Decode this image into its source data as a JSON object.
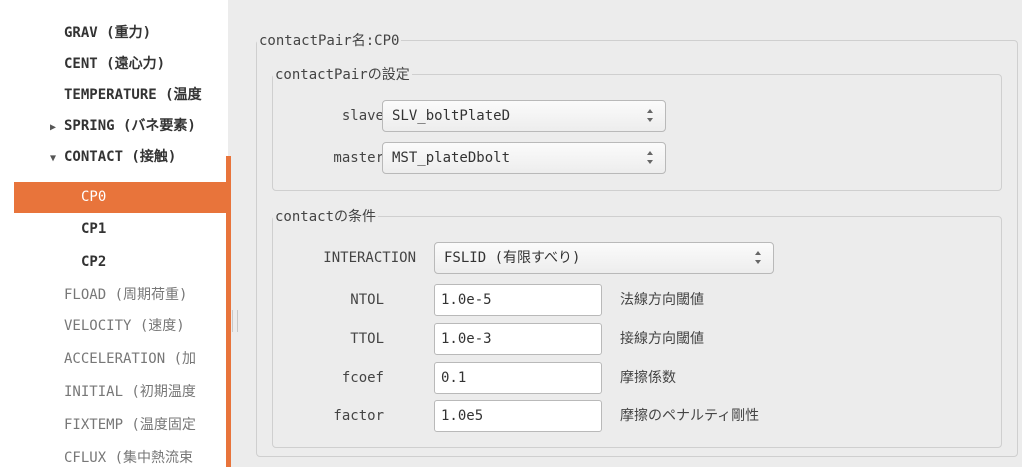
{
  "tree": {
    "items": [
      {
        "label": "GRAV (重力)",
        "style": "bold"
      },
      {
        "label": "CENT (遠心力)",
        "style": "bold"
      },
      {
        "label": "TEMPERATURE (温度",
        "style": "bold"
      },
      {
        "label": "SPRING (バネ要素)",
        "style": "bold",
        "arrow": "▶"
      },
      {
        "label": "CONTACT (接触)",
        "style": "bold",
        "arrow": "▼"
      },
      {
        "label": "CP0",
        "style": "selected"
      },
      {
        "label": "CP1",
        "style": "bold"
      },
      {
        "label": "CP2",
        "style": "bold"
      },
      {
        "label": "FLOAD (周期荷重)",
        "style": "gray"
      },
      {
        "label": "VELOCITY (速度)",
        "style": "gray"
      },
      {
        "label": "ACCELERATION (加",
        "style": "gray"
      },
      {
        "label": "INITIAL (初期温度",
        "style": "gray"
      },
      {
        "label": "FIXTEMP (温度固定",
        "style": "gray"
      },
      {
        "label": "CFLUX (集中熱流束",
        "style": "gray"
      }
    ]
  },
  "contact_pair": {
    "title": "contactPair名:CP0",
    "settings": {
      "title": "contactPairの設定",
      "slave_label": "slave",
      "slave_value": "SLV_boltPlateD",
      "master_label": "master",
      "master_value": "MST_plateDbolt"
    },
    "conditions": {
      "title": "contactの条件",
      "interaction_label": "INTERACTION",
      "interaction_value": "FSLID (有限すべり)",
      "ntol_label": "NTOL",
      "ntol_value": "1.0e-5",
      "ntol_desc": "法線方向閾値",
      "ttol_label": "TTOL",
      "ttol_value": "1.0e-3",
      "ttol_desc": "接線方向閾値",
      "fcoef_label": "fcoef",
      "fcoef_value": "0.1",
      "fcoef_desc": "摩擦係数",
      "factor_label": "factor",
      "factor_value": "1.0e5",
      "factor_desc": "摩擦のペナルティ剛性"
    }
  },
  "colors": {
    "selection": "#e8743b",
    "panel_bg": "#ececec"
  }
}
